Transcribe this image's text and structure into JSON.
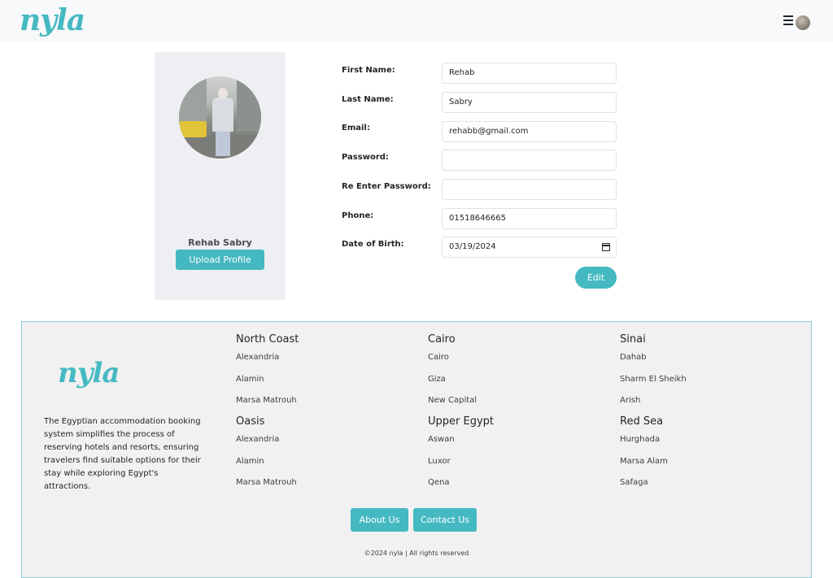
{
  "header": {
    "logo_text": "nyla",
    "menu_icon": "hamburger-icon",
    "avatar_icon": "user-avatar"
  },
  "profile": {
    "name": "Rehab Sabry",
    "upload_label": "Upload Profile"
  },
  "form": {
    "fields": [
      {
        "label": "First Name:",
        "value": "Rehab"
      },
      {
        "label": "Last Name:",
        "value": "Sabry"
      },
      {
        "label": "Email:",
        "value": "rehabb@gmail.com"
      },
      {
        "label": "Password:",
        "value": ""
      },
      {
        "label": "Re Enter Password:",
        "value": ""
      },
      {
        "label": "Phone:",
        "value": "01518646665"
      },
      {
        "label": "Date of Birth:",
        "value": "03/19/2024"
      }
    ],
    "edit_label": "Edit"
  },
  "footer": {
    "logo_text": "nyla",
    "description": "The Egyptian accommodation booking system simplifies the process of reserving hotels and resorts, ensuring travelers find suitable options for their stay while exploring Egypt's attractions.",
    "regions": [
      {
        "title": "North Coast",
        "cities": [
          "Alexandria",
          "Alamin",
          "Marsa Matrouh"
        ]
      },
      {
        "title": "Cairo",
        "cities": [
          "Cairo",
          "Giza",
          "New Capital"
        ]
      },
      {
        "title": "Sinai",
        "cities": [
          "Dahab",
          "Sharm El Sheikh",
          "Arish"
        ]
      },
      {
        "title": "Oasis",
        "cities": [
          "Alexandria",
          "Alamin",
          "Marsa Matrouh"
        ]
      },
      {
        "title": "Upper Egypt",
        "cities": [
          "Aswan",
          "Luxor",
          "Qena"
        ]
      },
      {
        "title": "Red Sea",
        "cities": [
          "Hurghada",
          "Marsa Alam",
          "Safaga"
        ]
      }
    ],
    "about_label": "About Us",
    "contact_label": "Contact Us",
    "copyright": "©2024 nyla | All rights reserved"
  },
  "colors": {
    "accent": "#45b9c2",
    "header_bg": "#f8f9fa",
    "card_bg": "#eeeff2",
    "footer_bg": "#f1f1f1"
  }
}
